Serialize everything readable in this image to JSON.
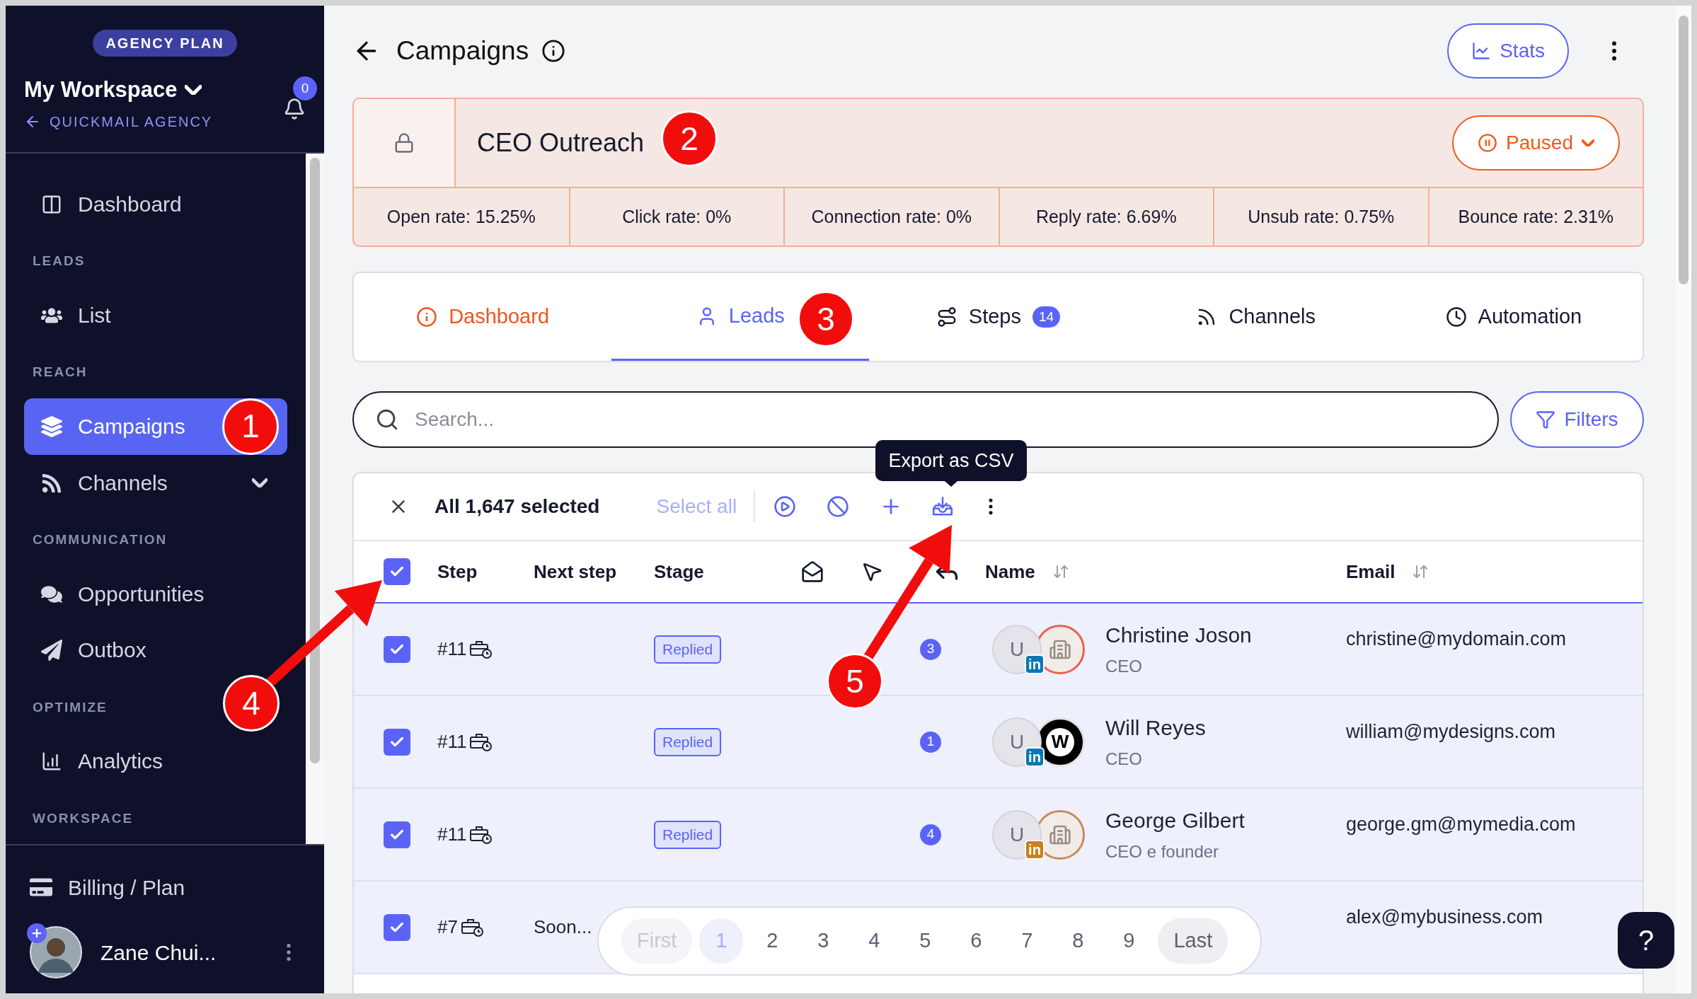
{
  "sidebar": {
    "plan_badge": "AGENCY PLAN",
    "workspace": "My Workspace",
    "agency_link": "QUICKMAIL AGENCY",
    "notification_count": "0",
    "nav": [
      {
        "kind": "item",
        "label": "Dashboard",
        "selected": false
      },
      {
        "kind": "section",
        "label": "LEADS"
      },
      {
        "kind": "item",
        "label": "List",
        "selected": false
      },
      {
        "kind": "section",
        "label": "REACH"
      },
      {
        "kind": "item",
        "label": "Campaigns",
        "selected": true
      },
      {
        "kind": "item",
        "label": "Channels",
        "selected": false,
        "expanded": false
      },
      {
        "kind": "section",
        "label": "COMMUNICATION"
      },
      {
        "kind": "item",
        "label": "Opportunities",
        "selected": false
      },
      {
        "kind": "item",
        "label": "Outbox",
        "selected": false
      },
      {
        "kind": "section",
        "label": "OPTIMIZE"
      },
      {
        "kind": "item",
        "label": "Analytics",
        "selected": false
      },
      {
        "kind": "section",
        "label": "WORKSPACE"
      }
    ],
    "footer": {
      "billing": "Billing / Plan",
      "user": "Zane Chui..."
    }
  },
  "page": {
    "title": "Campaigns",
    "stats_button": "Stats"
  },
  "campaign": {
    "name": "CEO Outreach",
    "locked": true,
    "status": "Paused",
    "rates": [
      "Open rate: 15.25%",
      "Click rate: 0%",
      "Connection rate: 0%",
      "Reply rate: 6.69%",
      "Unsub rate: 0.75%",
      "Bounce rate: 2.31%"
    ]
  },
  "tabs": [
    {
      "label": "Dashboard",
      "selected": false,
      "alert": true
    },
    {
      "label": "Leads",
      "selected": true,
      "alert": false
    },
    {
      "label": "Steps",
      "selected": false,
      "alert": false,
      "count": "14"
    },
    {
      "label": "Channels",
      "selected": false,
      "alert": false
    },
    {
      "label": "Automation",
      "selected": false,
      "alert": false
    }
  ],
  "search": {
    "placeholder": "Search...",
    "filters_button": "Filters"
  },
  "selection_bar": {
    "summary": "All 1,647 selected",
    "select_all": "Select all",
    "select_all_disabled": true,
    "tooltip": "Export as CSV"
  },
  "table": {
    "all_checked": true,
    "columns": [
      {
        "kind": "text",
        "label": "Step",
        "sortable": false
      },
      {
        "kind": "text",
        "label": "Next step",
        "sortable": false
      },
      {
        "kind": "text",
        "label": "Stage",
        "sortable": false
      },
      {
        "kind": "icon"
      },
      {
        "kind": "icon"
      },
      {
        "kind": "icon"
      },
      {
        "kind": "text",
        "label": "Name",
        "sortable": true
      },
      {
        "kind": "text",
        "label": "Email",
        "sortable": true
      }
    ],
    "rows": [
      {
        "checked": true,
        "step": "#11",
        "stage": "Replied",
        "replies": "3",
        "lead": {
          "initial": "U",
          "network": {
            "label": "in",
            "color": "#0a77b5"
          },
          "logo": {
            "kind": "building",
            "color": "#e8604c"
          },
          "name": "Christine Joson",
          "title": "CEO"
        },
        "email": "christine@mydomain.com"
      },
      {
        "checked": true,
        "step": "#11",
        "stage": "Replied",
        "replies": "1",
        "lead": {
          "initial": "U",
          "network": {
            "label": "in",
            "color": "#0a77b5"
          },
          "logo": {
            "kind": "monogram",
            "text": "W"
          },
          "name": "Will Reyes",
          "title": "CEO"
        },
        "email": "william@mydesigns.com"
      },
      {
        "checked": true,
        "step": "#11",
        "stage": "Replied",
        "replies": "4",
        "lead": {
          "initial": "U",
          "network": {
            "label": "in",
            "color": "#c9801f"
          },
          "logo": {
            "kind": "building",
            "color": "#c98a5a"
          },
          "name": "George Gilbert",
          "title": "CEO e founder"
        },
        "email": "george.gm@mymedia.com"
      },
      {
        "checked": true,
        "step": "#7",
        "next_step": "Soon...",
        "email": "alex@mybusiness.com"
      }
    ]
  },
  "pagination": [
    {
      "label": "First",
      "kind": "edge",
      "disabled": true,
      "selected": false
    },
    {
      "label": "1",
      "kind": "page",
      "selected": true
    },
    {
      "label": "2",
      "kind": "page",
      "selected": false
    },
    {
      "label": "3",
      "kind": "page",
      "selected": false
    },
    {
      "label": "4",
      "kind": "page",
      "selected": false
    },
    {
      "label": "5",
      "kind": "page",
      "selected": false
    },
    {
      "label": "6",
      "kind": "page",
      "selected": false
    },
    {
      "label": "7",
      "kind": "page",
      "selected": false
    },
    {
      "label": "8",
      "kind": "page",
      "selected": false
    },
    {
      "label": "9",
      "kind": "page",
      "selected": false
    },
    {
      "label": "Last",
      "kind": "edge",
      "disabled": false,
      "selected": false
    }
  ],
  "help_button": "?",
  "annotations": [
    {
      "label": "1",
      "arrow": false
    },
    {
      "label": "2",
      "arrow": false
    },
    {
      "label": "3",
      "arrow": false
    },
    {
      "label": "4",
      "arrow": true
    },
    {
      "label": "5",
      "arrow": true
    }
  ]
}
